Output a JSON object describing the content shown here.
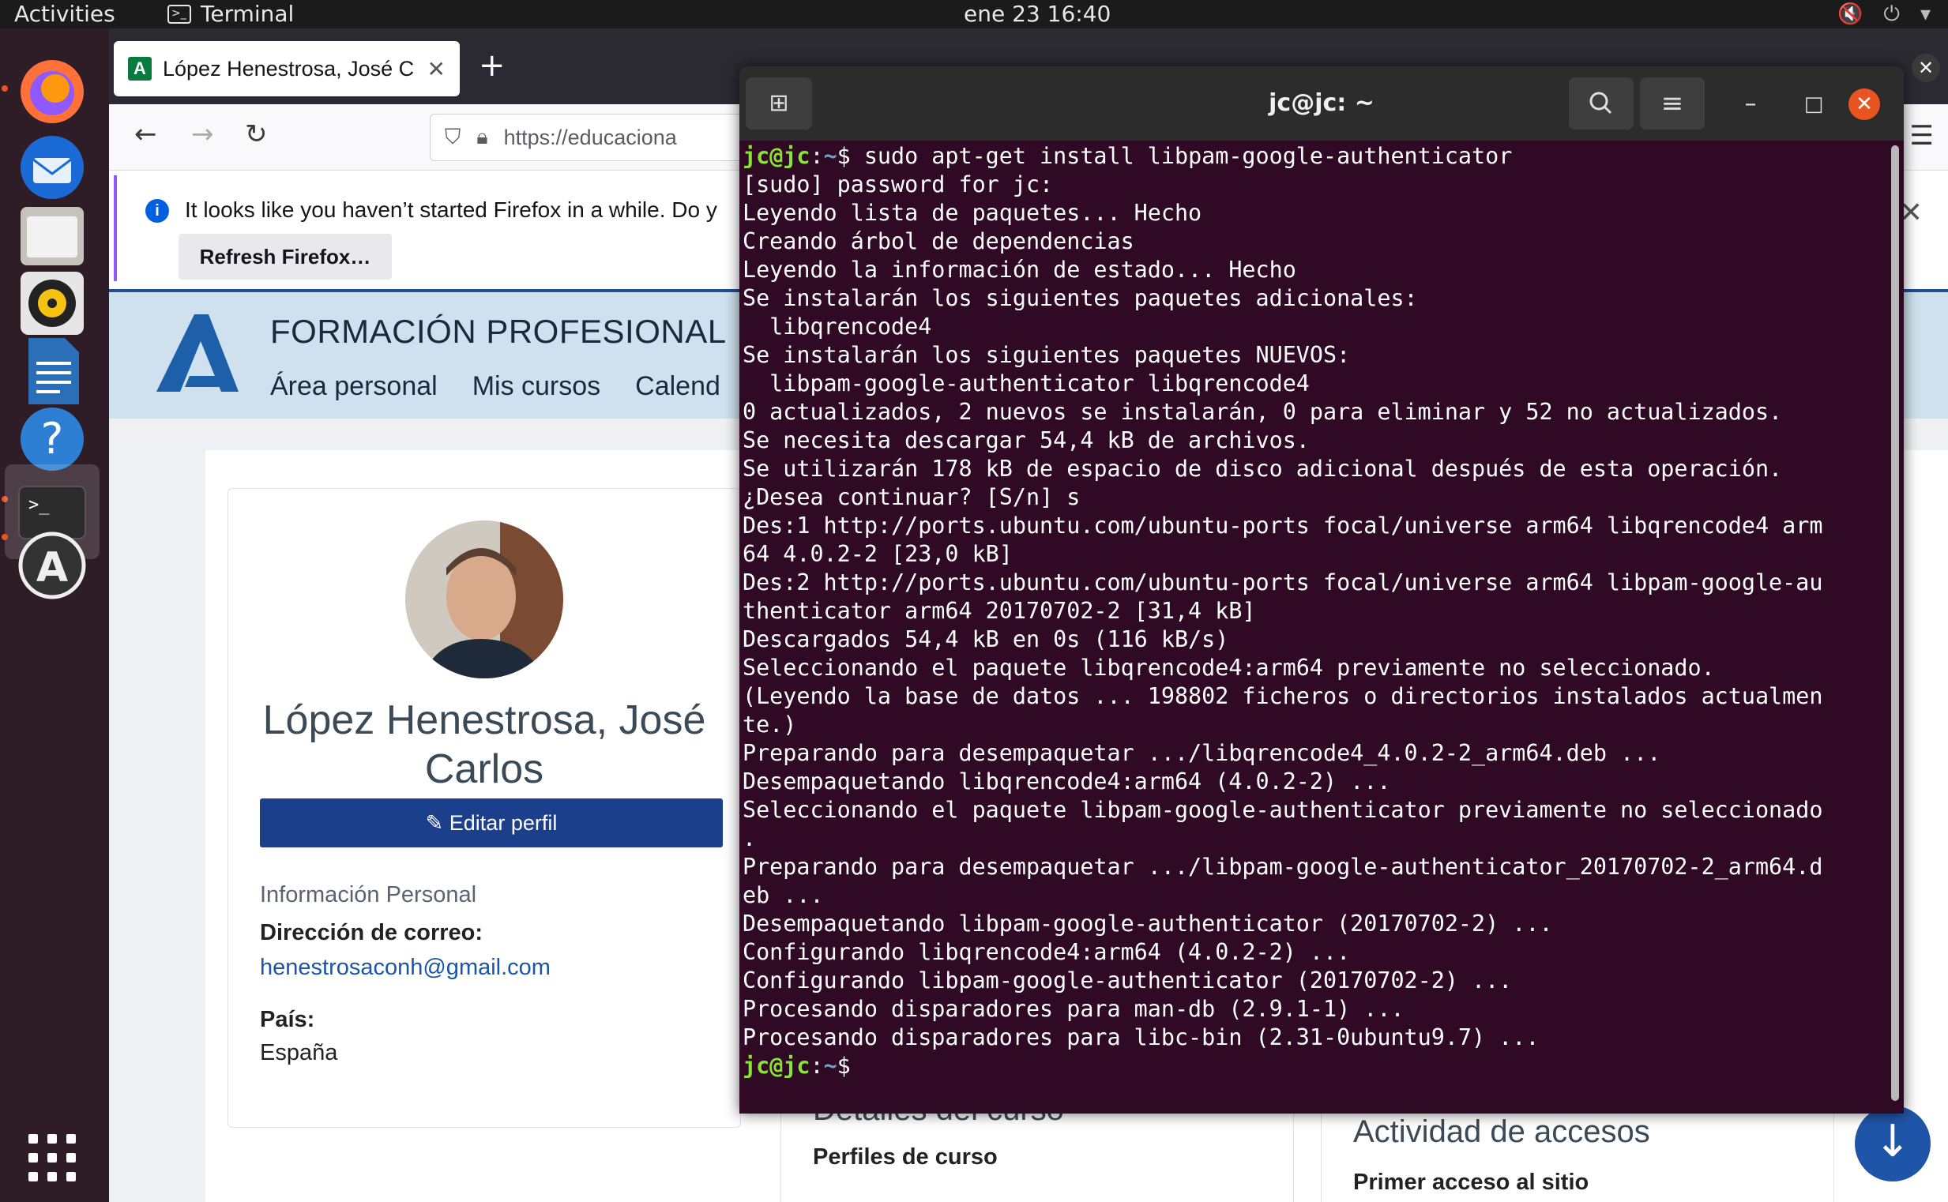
{
  "topbar": {
    "activities": "Activities",
    "app_name": "Terminal",
    "clock": "ene 23  16:40"
  },
  "dock": {
    "items": [
      "firefox-icon",
      "thunderbird-icon",
      "files-icon",
      "rhythmbox-icon",
      "writer-icon",
      "help-icon",
      "terminal-icon",
      "software-icon",
      "app-grid-icon"
    ]
  },
  "firefox": {
    "tab_title": "López Henestrosa, José C",
    "url": "https://educaciona",
    "notice_text": "It looks like you haven’t started Firefox in a while. Do y",
    "refresh_label": "Refresh Firefox…"
  },
  "moodle": {
    "site_title": "FORMACIÓN PROFESIONAL",
    "nav": [
      "Área personal",
      "Mis cursos",
      "Calend"
    ],
    "profile_name": "López Henestrosa, José Carlos",
    "edit_profile": "Editar perfil",
    "section": "Información Personal",
    "email_label": "Dirección de correo:",
    "email_value": "henestrosaconh@gmail.com",
    "country_label": "País:",
    "country_value": "España",
    "course_details_title": "Detalles del curso",
    "course_profiles": "Perfiles de curso",
    "access_title": "Actividad de accesos",
    "first_access": "Primer acceso al sitio"
  },
  "terminal": {
    "title": "jc@jc: ~",
    "prompt_user": "jc@jc",
    "prompt_path": "~",
    "command": "sudo apt-get install libpam-google-authenticator",
    "output": [
      "[sudo] password for jc:",
      "Leyendo lista de paquetes... Hecho",
      "Creando árbol de dependencias",
      "Leyendo la información de estado... Hecho",
      "Se instalarán los siguientes paquetes adicionales:",
      "  libqrencode4",
      "Se instalarán los siguientes paquetes NUEVOS:",
      "  libpam-google-authenticator libqrencode4",
      "0 actualizados, 2 nuevos se instalarán, 0 para eliminar y 52 no actualizados.",
      "Se necesita descargar 54,4 kB de archivos.",
      "Se utilizarán 178 kB de espacio de disco adicional después de esta operación.",
      "¿Desea continuar? [S/n] s",
      "Des:1 http://ports.ubuntu.com/ubuntu-ports focal/universe arm64 libqrencode4 arm",
      "64 4.0.2-2 [23,0 kB]",
      "Des:2 http://ports.ubuntu.com/ubuntu-ports focal/universe arm64 libpam-google-au",
      "thenticator arm64 20170702-2 [31,4 kB]",
      "Descargados 54,4 kB en 0s (116 kB/s)",
      "Seleccionando el paquete libqrencode4:arm64 previamente no seleccionado.",
      "(Leyendo la base de datos ... 198802 ficheros o directorios instalados actualmen",
      "te.)",
      "Preparando para desempaquetar .../libqrencode4_4.0.2-2_arm64.deb ...",
      "Desempaquetando libqrencode4:arm64 (4.0.2-2) ...",
      "Seleccionando el paquete libpam-google-authenticator previamente no seleccionado",
      ".",
      "Preparando para desempaquetar .../libpam-google-authenticator_20170702-2_arm64.d",
      "eb ...",
      "Desempaquetando libpam-google-authenticator (20170702-2) ...",
      "Configurando libqrencode4:arm64 (4.0.2-2) ...",
      "Configurando libpam-google-authenticator (20170702-2) ...",
      "Procesando disparadores para man-db (2.9.1-1) ...",
      "Procesando disparadores para libc-bin (2.31-0ubuntu9.7) ..."
    ]
  },
  "colors": {
    "terminal_bg": "#300a24",
    "prompt_user": "#8ae234",
    "prompt_path": "#729fcf",
    "ubuntu_orange": "#e95420",
    "moodle_button": "#1c3f8c"
  }
}
